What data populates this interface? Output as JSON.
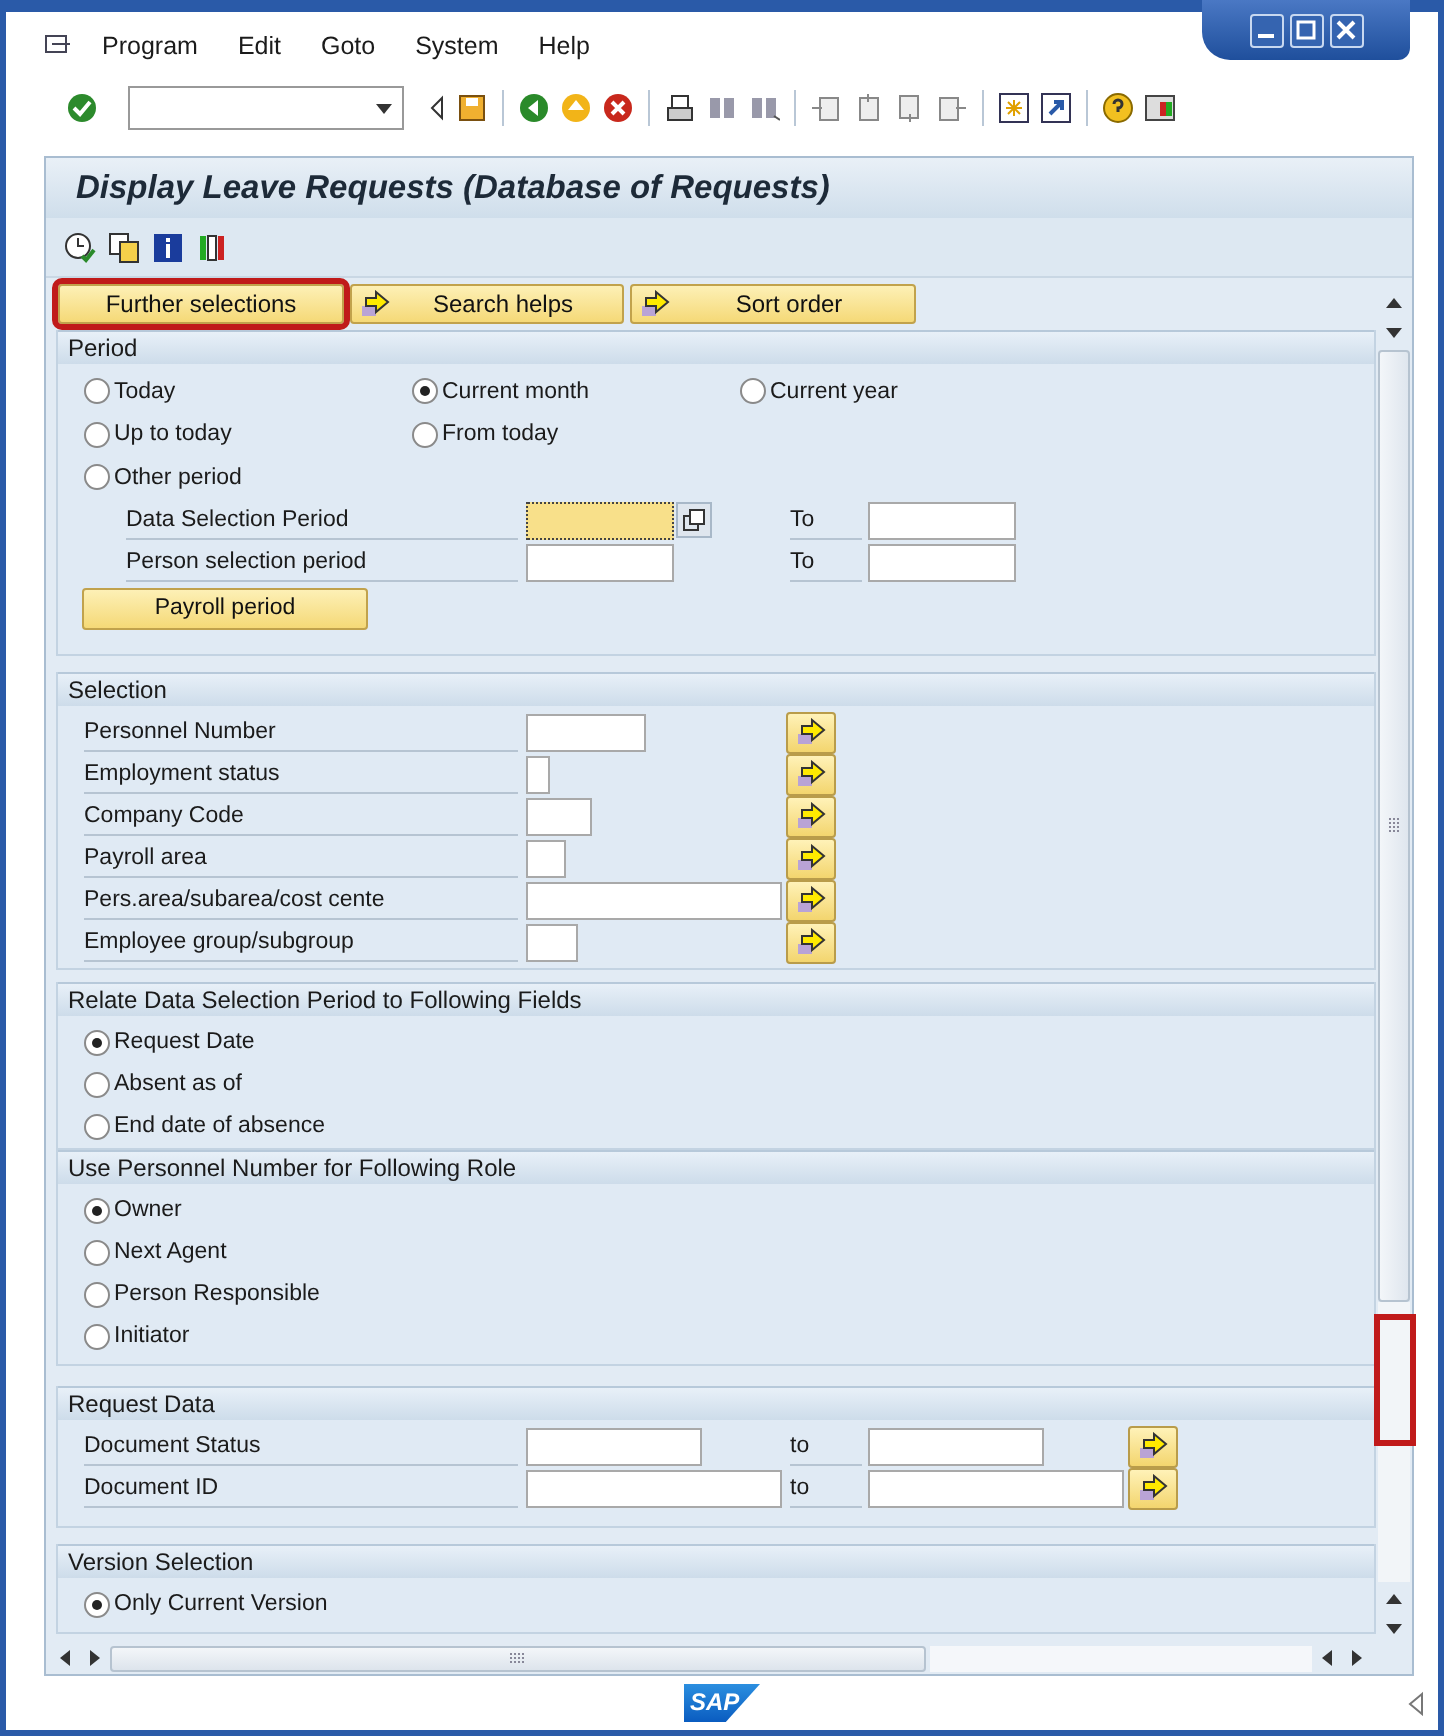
{
  "menu": [
    {
      "label": "Program"
    },
    {
      "label": "Edit"
    },
    {
      "label": "Goto"
    },
    {
      "label": "System"
    },
    {
      "label": "Help"
    }
  ],
  "title": "Display Leave Requests (Database of Requests)",
  "tabs": [
    {
      "label": "Further selections",
      "arrow": false,
      "highlighted": true
    },
    {
      "label": "Search helps",
      "arrow": true,
      "highlighted": false
    },
    {
      "label": "Sort order",
      "arrow": true,
      "highlighted": false
    }
  ],
  "sections": [
    {
      "kind": "period",
      "title": "Period",
      "options": [
        {
          "label": "Today",
          "selected": false
        },
        {
          "label": "Current month",
          "selected": true
        },
        {
          "label": "Current year",
          "selected": false
        },
        {
          "label": "Up to today",
          "selected": false
        },
        {
          "label": "From today",
          "selected": false
        },
        {
          "label": "Other period",
          "selected": false
        }
      ],
      "ranges": [
        {
          "label": "Data Selection Period",
          "to": "To",
          "focused": true
        },
        {
          "label": "Person selection period",
          "to": "To",
          "focused": false
        }
      ],
      "button": "Payroll period"
    },
    {
      "kind": "fields",
      "title": "Selection",
      "fields": [
        {
          "label": "Personnel Number"
        },
        {
          "label": "Employment status"
        },
        {
          "label": "Company Code"
        },
        {
          "label": "Payroll area"
        },
        {
          "label": "Pers.area/subarea/cost cente"
        },
        {
          "label": "Employee group/subgroup"
        }
      ]
    },
    {
      "kind": "radios",
      "title": "Relate Data Selection Period to Following Fields",
      "options": [
        {
          "label": "Request Date",
          "selected": true
        },
        {
          "label": "Absent as of",
          "selected": false
        },
        {
          "label": "End date of absence",
          "selected": false
        }
      ]
    },
    {
      "kind": "radios",
      "title": "Use Personnel Number for Following Role",
      "options": [
        {
          "label": "Owner",
          "selected": true
        },
        {
          "label": "Next Agent",
          "selected": false
        },
        {
          "label": "Person Responsible",
          "selected": false
        },
        {
          "label": "Initiator",
          "selected": false
        }
      ]
    },
    {
      "kind": "ranges",
      "title": "Request Data",
      "ranges": [
        {
          "label": "Document Status",
          "to": "to"
        },
        {
          "label": "Document ID",
          "to": "to"
        }
      ]
    },
    {
      "kind": "radios",
      "title": "Version Selection",
      "options": [
        {
          "label": "Only Current Version",
          "selected": true
        }
      ]
    }
  ],
  "scrollbar_highlighted": true,
  "logo": "SAP"
}
